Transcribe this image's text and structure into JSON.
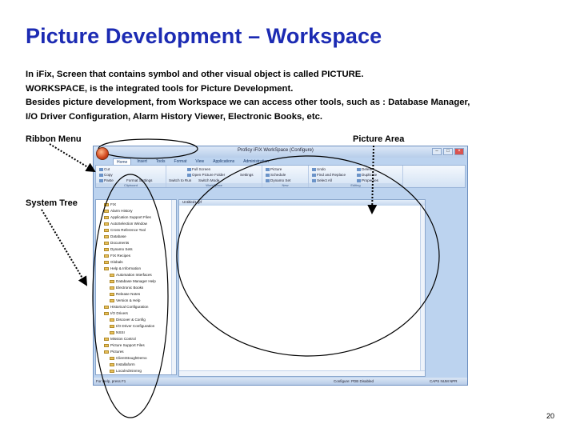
{
  "slide": {
    "title": "Picture Development – Workspace",
    "body_lines": [
      "In iFix, Screen that contains symbol and other visual object is called PICTURE.",
      "WORKSPACE, is the integrated tools for Picture Development.",
      "Besides picture development, from Workspace we can access other tools, such as : Database Manager,",
      "I/O Driver Configuration, Alarm History Viewer,  Electronic Books, etc."
    ],
    "callouts": {
      "ribbon": "Ribbon Menu",
      "picture": "Picture Area",
      "tree": "System Tree"
    },
    "page_number": "20"
  },
  "workspace": {
    "title": "Proficy iFIX WorkSpace (Configure)",
    "tabs": [
      "Home",
      "Insert",
      "Tools",
      "Format",
      "View",
      "Applications",
      "Administration"
    ],
    "active_tab": "Home",
    "ribbon": {
      "clipboard": {
        "name": "Clipboard",
        "items": [
          "Cut",
          "Copy",
          "Paste",
          "Format Settings"
        ]
      },
      "workspace": {
        "name": "WorkSpace",
        "items": [
          "Full Screen",
          "Open Picture Folder",
          "Switch to Run",
          "Switch Mode",
          "Settings"
        ]
      },
      "new": {
        "name": "New",
        "items": [
          "Picture",
          "Schedule",
          "Dynamo Set"
        ]
      },
      "editing": {
        "name": "Editing",
        "items": [
          "Undo",
          "Find and Replace",
          "Select All",
          "Delete",
          "Duplicate",
          "Properties"
        ]
      }
    },
    "tree": [
      "FIX",
      "Alarm History",
      "Application Support Files",
      "AutoSelection Window",
      "Cross Reference Tool",
      "Database",
      "Documents",
      "Dynamo Sets",
      "FIX Recipes",
      "Globals",
      "Help & Information",
      "Automation Interfaces",
      "Database Manager Help",
      "Electronic Books",
      "Release Notes",
      "Version & Help",
      "Historical Configuration",
      "I/O Drivers",
      "Discover & Config",
      "I/O Driver Configuration",
      "NSSI",
      "Mission Control",
      "Picture Support Files",
      "Pictures",
      "ClientStoughDemo",
      "Installaform",
      "LocalAdminmrg"
    ],
    "picture_tab": "Untitled1.grf",
    "status_left": "For Help, press F1",
    "status_mid": "Configure: PDB Disabled",
    "status_right": "CAPS NUM NPR"
  }
}
